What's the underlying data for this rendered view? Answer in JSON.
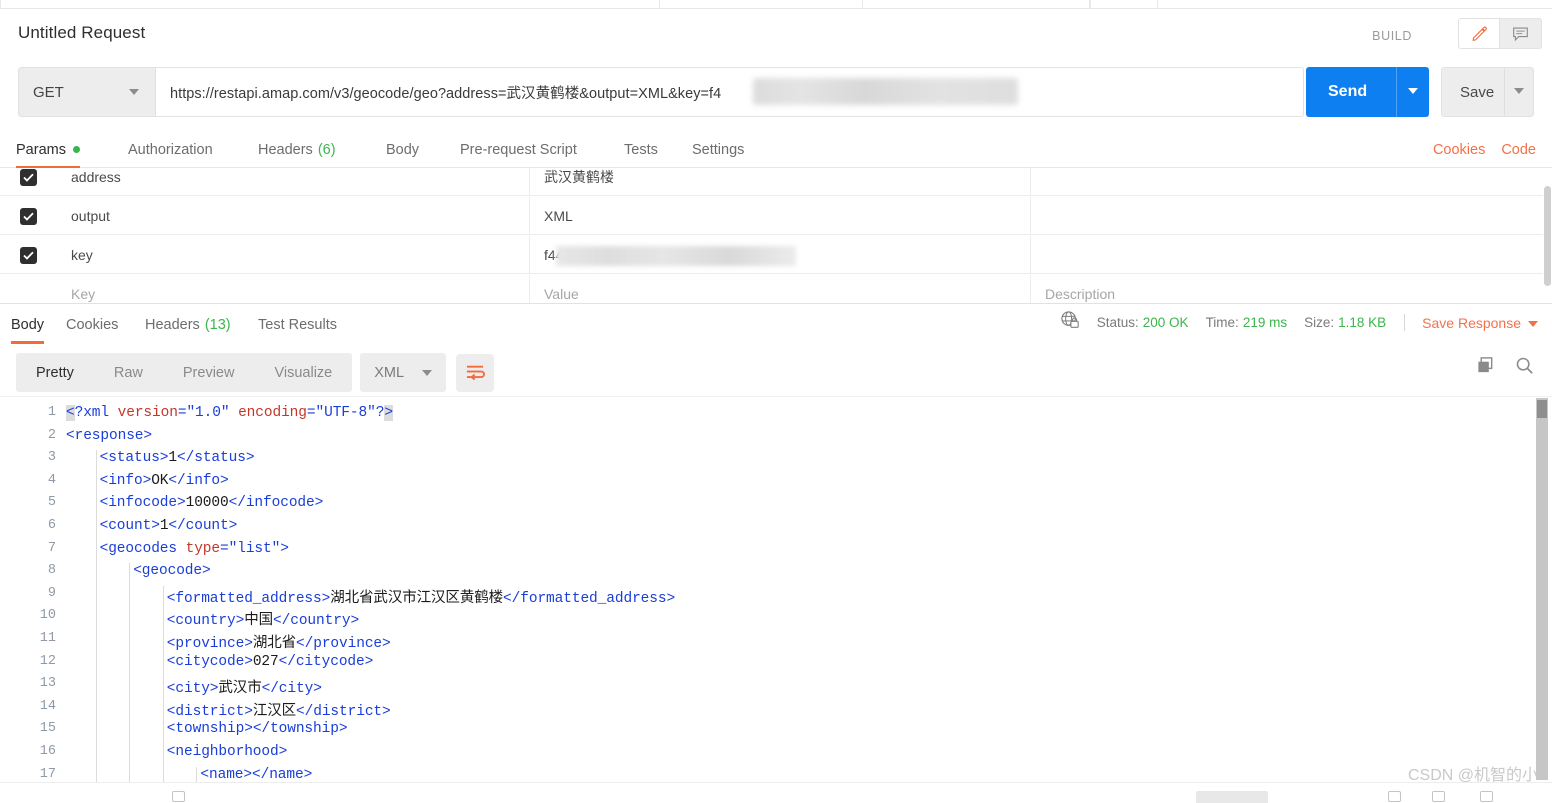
{
  "request": {
    "title": "Untitled Request",
    "build_label": "BUILD",
    "method": "GET",
    "url": "https://restapi.amap.com/v3/geocode/geo?address=武汉黄鹤楼&output=XML&key=f4",
    "send_label": "Send",
    "save_label": "Save",
    "tabs": [
      {
        "label": "Params",
        "badge_dot": true,
        "active": true
      },
      {
        "label": "Authorization",
        "active": false
      },
      {
        "label": "Headers",
        "count": "(6)",
        "active": false
      },
      {
        "label": "Body",
        "active": false
      },
      {
        "label": "Pre-request Script",
        "active": false
      },
      {
        "label": "Tests",
        "active": false
      },
      {
        "label": "Settings",
        "active": false
      }
    ],
    "right_links": [
      "Cookies",
      "Code"
    ]
  },
  "params": {
    "columns": [
      "Key",
      "Value",
      "Description"
    ],
    "rows": [
      {
        "checked": true,
        "key": "address",
        "value": "武汉黄鹤楼",
        "description": "",
        "masked": false
      },
      {
        "checked": true,
        "key": "output",
        "value": "XML",
        "description": "",
        "masked": false
      },
      {
        "checked": true,
        "key": "key",
        "value": "f44",
        "description": "",
        "masked": true
      }
    ],
    "placeholder_row": {
      "key": "Key",
      "value": "Value",
      "description": "Description"
    }
  },
  "response": {
    "tabs": [
      {
        "label": "Body",
        "active": true
      },
      {
        "label": "Cookies",
        "active": false
      },
      {
        "label": "Headers",
        "count": "(13)",
        "active": false
      },
      {
        "label": "Test Results",
        "active": false
      }
    ],
    "meta": {
      "status_label": "Status:",
      "status_value": "200 OK",
      "time_label": "Time:",
      "time_value": "219 ms",
      "size_label": "Size:",
      "size_value": "1.18 KB",
      "save_response": "Save Response"
    },
    "toolbar": {
      "view_modes": [
        {
          "label": "Pretty",
          "active": true
        },
        {
          "label": "Raw",
          "active": false
        },
        {
          "label": "Preview",
          "active": false
        },
        {
          "label": "Visualize",
          "active": false
        }
      ],
      "format": "XML"
    },
    "code": {
      "lines": [
        {
          "n": "1",
          "indent": 0,
          "tokens": [
            {
              "t": "punct",
              "v": "<",
              "hl": true
            },
            {
              "t": "tag",
              "v": "?xml "
            },
            {
              "t": "attr",
              "v": "version"
            },
            {
              "t": "punct",
              "v": "="
            },
            {
              "t": "str",
              "v": "\"1.0\""
            },
            {
              "t": "punct",
              "v": " "
            },
            {
              "t": "attr",
              "v": "encoding"
            },
            {
              "t": "punct",
              "v": "="
            },
            {
              "t": "str",
              "v": "\"UTF-8\""
            },
            {
              "t": "tag",
              "v": "?"
            },
            {
              "t": "punct",
              "v": ">",
              "hl": true
            }
          ]
        },
        {
          "n": "2",
          "indent": 0,
          "tokens": [
            {
              "t": "tag",
              "v": "<response>"
            }
          ]
        },
        {
          "n": "3",
          "indent": 1,
          "tokens": [
            {
              "t": "tag",
              "v": "<status>"
            },
            {
              "t": "txt",
              "v": "1"
            },
            {
              "t": "tag",
              "v": "</status>"
            }
          ]
        },
        {
          "n": "4",
          "indent": 1,
          "tokens": [
            {
              "t": "tag",
              "v": "<info>"
            },
            {
              "t": "txt",
              "v": "OK"
            },
            {
              "t": "tag",
              "v": "</info>"
            }
          ]
        },
        {
          "n": "5",
          "indent": 1,
          "tokens": [
            {
              "t": "tag",
              "v": "<infocode>"
            },
            {
              "t": "txt",
              "v": "10000"
            },
            {
              "t": "tag",
              "v": "</infocode>"
            }
          ]
        },
        {
          "n": "6",
          "indent": 1,
          "tokens": [
            {
              "t": "tag",
              "v": "<count>"
            },
            {
              "t": "txt",
              "v": "1"
            },
            {
              "t": "tag",
              "v": "</count>"
            }
          ]
        },
        {
          "n": "7",
          "indent": 1,
          "tokens": [
            {
              "t": "tag",
              "v": "<geocodes "
            },
            {
              "t": "attr",
              "v": "type"
            },
            {
              "t": "punct",
              "v": "="
            },
            {
              "t": "str",
              "v": "\"list\""
            },
            {
              "t": "tag",
              "v": ">"
            }
          ]
        },
        {
          "n": "8",
          "indent": 2,
          "tokens": [
            {
              "t": "tag",
              "v": "<geocode>"
            }
          ]
        },
        {
          "n": "9",
          "indent": 3,
          "tokens": [
            {
              "t": "tag",
              "v": "<formatted_address>"
            },
            {
              "t": "txt",
              "v": "湖北省武汉市江汉区黄鹤楼"
            },
            {
              "t": "tag",
              "v": "</formatted_address>"
            }
          ]
        },
        {
          "n": "10",
          "indent": 3,
          "tokens": [
            {
              "t": "tag",
              "v": "<country>"
            },
            {
              "t": "txt",
              "v": "中国"
            },
            {
              "t": "tag",
              "v": "</country>"
            }
          ]
        },
        {
          "n": "11",
          "indent": 3,
          "tokens": [
            {
              "t": "tag",
              "v": "<province>"
            },
            {
              "t": "txt",
              "v": "湖北省"
            },
            {
              "t": "tag",
              "v": "</province>"
            }
          ]
        },
        {
          "n": "12",
          "indent": 3,
          "tokens": [
            {
              "t": "tag",
              "v": "<citycode>"
            },
            {
              "t": "txt",
              "v": "027"
            },
            {
              "t": "tag",
              "v": "</citycode>"
            }
          ]
        },
        {
          "n": "13",
          "indent": 3,
          "tokens": [
            {
              "t": "tag",
              "v": "<city>"
            },
            {
              "t": "txt",
              "v": "武汉市"
            },
            {
              "t": "tag",
              "v": "</city>"
            }
          ]
        },
        {
          "n": "14",
          "indent": 3,
          "tokens": [
            {
              "t": "tag",
              "v": "<district>"
            },
            {
              "t": "txt",
              "v": "江汉区"
            },
            {
              "t": "tag",
              "v": "</district>"
            }
          ]
        },
        {
          "n": "15",
          "indent": 3,
          "tokens": [
            {
              "t": "tag",
              "v": "<township>"
            },
            {
              "t": "tag",
              "v": "</township>"
            }
          ]
        },
        {
          "n": "16",
          "indent": 3,
          "tokens": [
            {
              "t": "tag",
              "v": "<neighborhood>"
            }
          ]
        },
        {
          "n": "17",
          "indent": 4,
          "tokens": [
            {
              "t": "tag",
              "v": "<name>"
            },
            {
              "t": "tag",
              "v": "</name>"
            }
          ]
        }
      ]
    }
  },
  "watermark": "CSDN @机智的小"
}
